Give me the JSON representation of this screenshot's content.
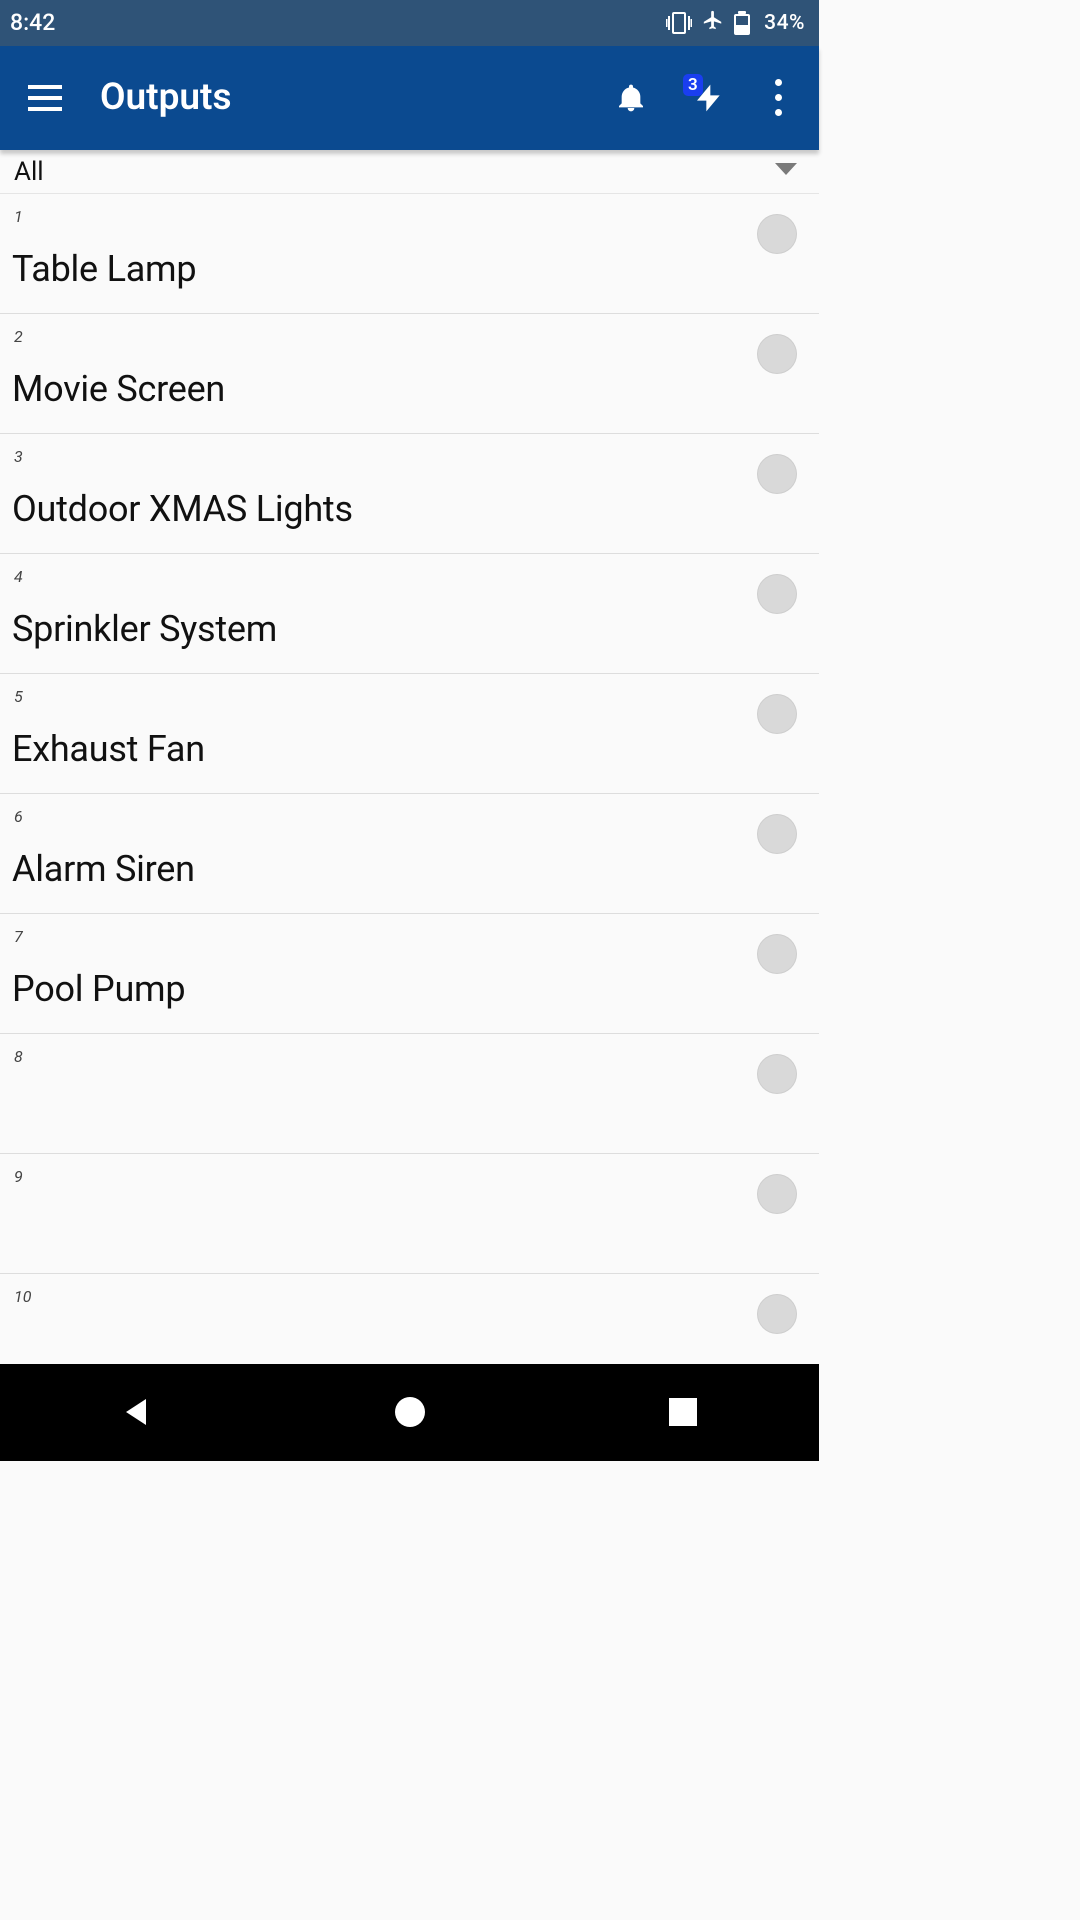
{
  "status": {
    "time": "8:42",
    "battery_pct": "34%"
  },
  "appbar": {
    "title": "Outputs",
    "bolt_badge": "3"
  },
  "filter": {
    "label": "All"
  },
  "outputs": [
    {
      "idx": "1",
      "name": "Table Lamp"
    },
    {
      "idx": "2",
      "name": "Movie Screen"
    },
    {
      "idx": "3",
      "name": "Outdoor XMAS Lights"
    },
    {
      "idx": "4",
      "name": "Sprinkler System"
    },
    {
      "idx": "5",
      "name": "Exhaust Fan"
    },
    {
      "idx": "6",
      "name": "Alarm Siren"
    },
    {
      "idx": "7",
      "name": "Pool Pump"
    },
    {
      "idx": "8",
      "name": ""
    },
    {
      "idx": "9",
      "name": ""
    },
    {
      "idx": "10",
      "name": ""
    }
  ]
}
